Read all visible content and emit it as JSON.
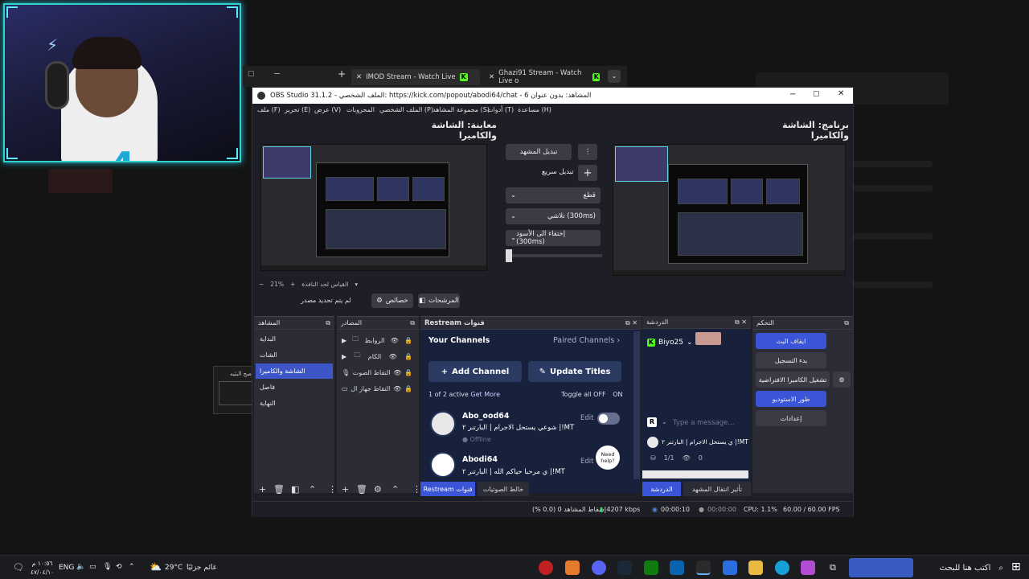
{
  "browser": {
    "tab1": "IMOD Stream - Watch Live",
    "tab2": "Ghazi91 Stream - Watch Live o"
  },
  "obs": {
    "title": "OBS Studio 31.1.2 - الملف الشخصي: https://kick.com/popout/abodi64/chat - المشاهد: بدون عنوان 6",
    "menu": [
      "ملف (F)",
      "تحرير (E)",
      "عرض (V)",
      "المحزوبات",
      "الملف الشخصي (P)",
      "مجموعة المشاهد (S)",
      "أدوات (T)",
      "مساعدة (H)"
    ],
    "preview_title": "معاينة: الشاشة والكاميرا",
    "program_title": "برنامج: الشاشة والكاميرا",
    "transition": {
      "edit_scene": "تبديل المشهد",
      "quick": "تبديل سريع",
      "cut": "قطع",
      "fade": "تلاشي (300ms)",
      "fade_black": "إختفاء الى الأسود (300ms)"
    },
    "zoom": "21%",
    "zoom_label": "القياس لحد النافذة",
    "no_source": "لم يتم تحديد مصدر",
    "properties": "خصائص",
    "filters": "المرشحات",
    "docks": {
      "scenes": "المشاهد",
      "sources": "المصادر",
      "restream": "Restream قنوات",
      "chat": "الدردشة",
      "controls": "التحكم"
    },
    "scenes": [
      "البداية",
      "الشات",
      "الشاشة والكاميرا",
      "فاصل",
      "النهاية"
    ],
    "sources": [
      "الروابط",
      "الكام",
      "التقاط الصوت",
      "التقاط جهاز ال"
    ],
    "restream": {
      "your_channels": "Your Channels",
      "paired": "Paired Channels",
      "add_channel": "Add Channel",
      "update_titles": "Update Titles",
      "active": "1 of 2 active",
      "get_more": "Get More",
      "toggle_all": "Toggle all OFF",
      "on": "ON",
      "channels": [
        {
          "name": "Abo_ood64",
          "title": "شوعي يستحل الاجرام | البارتنر ٢ |!MT",
          "status": "Offline",
          "edit": "Edit"
        },
        {
          "name": "Abodi64",
          "title": "ي مرحبا حياكم الله | البارتنر ٢ |!MT",
          "status": "",
          "edit": "Edit"
        }
      ],
      "need_help": "Need help?"
    },
    "chat": {
      "user": "Biyo25",
      "placeholder": "Type a message...",
      "stream_title": "ي يستحل الاجرام | البارتنر ٢ |!MT",
      "viewers_ratio": "1/1",
      "views": "0"
    },
    "controls": {
      "stop_stream": "ايقاف البث",
      "start_record": "بدء التسجيل",
      "virtual_cam": "تشغيل الكاميرا الافتراضية",
      "studio_mode": "طور الاستوديو",
      "settings": "إعدادات"
    },
    "bottom_tabs": {
      "restream": "Restream قنوات",
      "mixer": "خالط الصوتيات",
      "chat": "الدردشة",
      "transitions": "تأثير انتقال المشهد"
    },
    "status": {
      "dropped": "إسقاط المشاهد 0 (0.0 %)",
      "bitrate": "4207 kbps",
      "live_time": "00:00:10",
      "rec_time": "00:00:00",
      "cpu": "CPU: 1.1%",
      "fps": "60.00 / 60.00 FPS"
    }
  },
  "bg_popup": "صح البثيه",
  "taskbar": {
    "search": "اكتب هنا للبحث",
    "weather_temp": "29°C",
    "weather_text": "غائم جزئيًا",
    "lang": "ENG",
    "time": "١٠:٥٦ م",
    "date": "٤٧/٠٤/١٠"
  }
}
